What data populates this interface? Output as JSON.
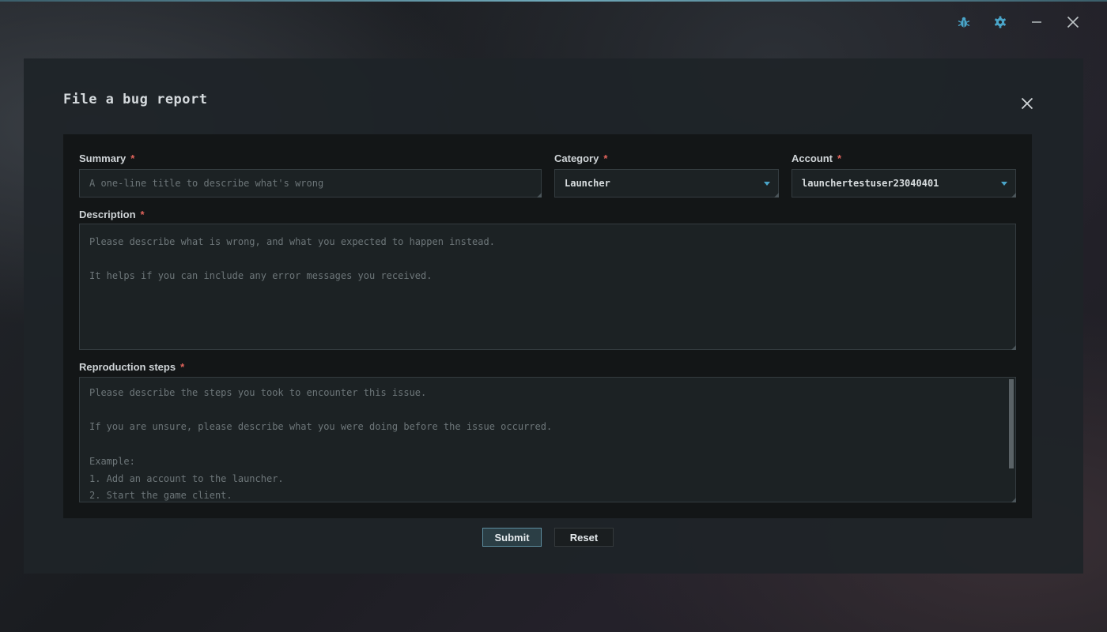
{
  "window": {
    "controls": [
      {
        "name": "bug-icon",
        "color": "#4aa5c9"
      },
      {
        "name": "gear-icon",
        "color": "#4aa5c9"
      },
      {
        "name": "minimize-icon",
        "color": "#bfc5c8"
      },
      {
        "name": "close-icon",
        "color": "#bfc5c8"
      }
    ]
  },
  "dialog": {
    "title": "File a bug report",
    "close_icon": "close-icon"
  },
  "form": {
    "required_marker": "*",
    "summary": {
      "label": "Summary",
      "value": "",
      "placeholder": "A one-line title to describe what's wrong"
    },
    "category": {
      "label": "Category",
      "selected": "Launcher"
    },
    "account": {
      "label": "Account",
      "selected": "launchertestuser23040401"
    },
    "description": {
      "label": "Description",
      "placeholder": "Please describe what is wrong, and what you expected to happen instead.\n\nIt helps if you can include any error messages you received."
    },
    "reproduction": {
      "label": "Reproduction steps",
      "placeholder": "Please describe the steps you took to encounter this issue.\n\nIf you are unsure, please describe what you were doing before the issue occurred.\n\nExample:\n1. Add an account to the launcher.\n2. Start the game client."
    }
  },
  "buttons": {
    "submit": "Submit",
    "reset": "Reset"
  },
  "colors": {
    "accent": "#4aa5c9",
    "required": "#e2645c"
  }
}
